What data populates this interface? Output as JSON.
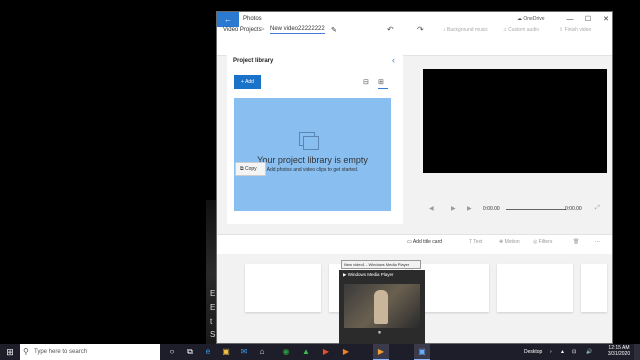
{
  "desktop": {
    "background_text": [
      "E",
      "E",
      "t",
      "S"
    ]
  },
  "window": {
    "title": "Photos",
    "onedrive_label": "OneDrive",
    "controls": {
      "minimize": "—",
      "maximize": "☐",
      "close": "✕"
    },
    "back_icon": "←"
  },
  "toolbar": {
    "breadcrumb": "Video Projects",
    "separator": ">",
    "project_name": "New video22222222",
    "edit_icon": "✎",
    "undo_icon": "↶",
    "redo_icon": "↷",
    "background_music": "Background music",
    "custom_audio": "Custom audio",
    "finish_video": "Finish video"
  },
  "library": {
    "title": "Project library",
    "collapse_icon": "‹",
    "add_label": "+ Add",
    "view_icon_1": "⊟",
    "view_icon_2": "⊞",
    "empty_title": "Your project library is empty",
    "empty_subtitle": "Add photos and video clips to get started.",
    "copy_tooltip": "Copy"
  },
  "player": {
    "prev_icon": "◀",
    "play_icon": "▶",
    "next_icon": "▶",
    "time_start": "0:00.00",
    "time_end": "0:00.00",
    "fullscreen_icon": "⤢"
  },
  "storyboard": {
    "add_title_card": "Add title card",
    "text": "Text",
    "motion": "Motion",
    "filters": "Filters",
    "delete_icon": "🗑",
    "more_icon": "⋯"
  },
  "wmp_preview": {
    "tooltip": "New video1 - Windows Media Player",
    "title": "Windows Media Player",
    "pause_icon": "⏸"
  },
  "taskbar": {
    "start_icon": "⊞",
    "search_placeholder": "Type here to search",
    "search_icon": "⚲",
    "apps": [
      "○",
      "⧉",
      "e",
      "▣",
      "✉",
      "⌂",
      "◉",
      "▲",
      "▶",
      "▶",
      "▶",
      "▣"
    ],
    "desktop_label": "Desktop",
    "tray_icons": [
      "›",
      "▲",
      "⊡",
      "🔊"
    ],
    "time": "12:15 AM",
    "date": "3/31/2020",
    "colors": {
      "taskbar": "#1e1e2a",
      "accent": "#1a73c9"
    }
  }
}
